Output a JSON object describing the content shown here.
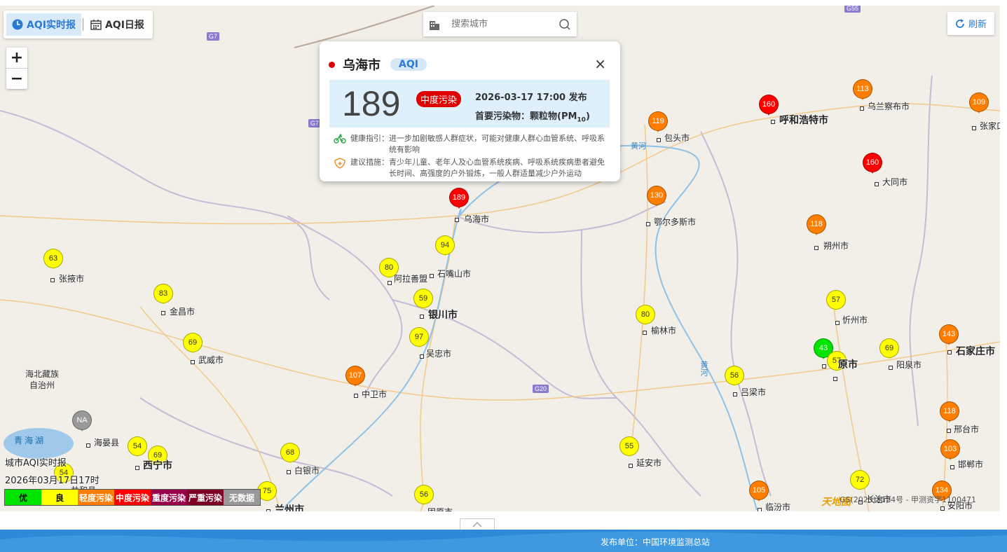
{
  "tabs": [
    {
      "label": "AQI实时报",
      "icon": "clock-icon",
      "active": true
    },
    {
      "label": "AQI日报",
      "icon": "calendar-icon",
      "active": false
    }
  ],
  "search": {
    "placeholder": "搜索城市"
  },
  "refresh": {
    "label": "刷新"
  },
  "zoom": {
    "in": "+",
    "out": "−"
  },
  "popup": {
    "city": "乌海市",
    "tag": "AQI",
    "aqi": "189",
    "level": "中度污染",
    "time": "2026-03-17 17:00 发布",
    "pollutant_label": "首要污染物：",
    "pollutant": "颗粒物(PM",
    "pollutant_sub": "10",
    "pollutant_end": ")",
    "health_label": "健康指引：",
    "health_text": "进一步加剧敏感人群症状，可能对健康人群心血管系统、呼吸系统有影响",
    "advice_label": "建议措施：",
    "advice_text": "青少年儿童、老年人及心血管系统疾病、呼吸系统疾病患者避免长时间、高强度的户外锻炼，一般人群适量减少户外运动",
    "close": "×"
  },
  "colors": {
    "good": "#ffff00",
    "excellent": "#00e400",
    "light": "#ff7e00",
    "moderate": "#ff0000",
    "heavy": "#99004c",
    "severe": "#7e0023",
    "nodata": "#999999"
  },
  "stations": [
    {
      "value": "189",
      "level": "moderate",
      "city": "乌海市"
    },
    {
      "value": "160",
      "level": "moderate",
      "city": "呼和浩特市"
    },
    {
      "value": "160",
      "level": "moderate",
      "city": "大同市"
    },
    {
      "value": "113",
      "level": "light",
      "city": "乌兰察布市"
    },
    {
      "value": "109",
      "level": "light",
      "city": "张家口"
    },
    {
      "value": "119",
      "level": "light",
      "city": "包头市"
    },
    {
      "value": "130",
      "level": "light",
      "city": "鄂尔多斯市"
    },
    {
      "value": "118",
      "level": "light",
      "city": "朔州市"
    },
    {
      "value": "94",
      "level": "good",
      "city": "石嘴山市"
    },
    {
      "value": "80",
      "level": "good",
      "city": "阿拉善盟"
    },
    {
      "value": "59",
      "level": "good",
      "city": "银川市"
    },
    {
      "value": "97",
      "level": "good",
      "city": "吴忠市"
    },
    {
      "value": "107",
      "level": "light",
      "city": "中卫市"
    },
    {
      "value": "63",
      "level": "good",
      "city": "张掖市"
    },
    {
      "value": "83",
      "level": "good",
      "city": "金昌市"
    },
    {
      "value": "69",
      "level": "good",
      "city": "武威市"
    },
    {
      "value": "80",
      "level": "good",
      "city": "榆林市"
    },
    {
      "value": "57",
      "level": "good",
      "city": "忻州市"
    },
    {
      "value": "43",
      "level": "excellent",
      "city": ""
    },
    {
      "value": "57",
      "level": "good",
      "city": ""
    },
    {
      "value": "69",
      "level": "good",
      "city": "阳泉市"
    },
    {
      "value": "143",
      "level": "light",
      "city": "石家庄市"
    },
    {
      "value": "56",
      "level": "good",
      "city": "吕梁市"
    },
    {
      "value": "118",
      "level": "light",
      "city": "邢台市"
    },
    {
      "value": "103",
      "level": "light",
      "city": "邯郸市"
    },
    {
      "value": "NA",
      "level": "nodata",
      "city": "海晏县"
    },
    {
      "value": "54",
      "level": "good",
      "city": ""
    },
    {
      "value": "69",
      "level": "good",
      "city": "西宁市"
    },
    {
      "value": "54",
      "level": "good",
      "city": "共和县"
    },
    {
      "value": "68",
      "level": "good",
      "city": "白银市"
    },
    {
      "value": "75",
      "level": "good",
      "city": "兰州市"
    },
    {
      "value": "55",
      "level": "good",
      "city": "延安市"
    },
    {
      "value": "56",
      "level": "good",
      "city": "固原市"
    },
    {
      "value": "105",
      "level": "light",
      "city": "临汾市"
    },
    {
      "value": "72",
      "level": "good",
      "city": "长治市"
    },
    {
      "value": "134",
      "level": "light",
      "city": "安阳市"
    }
  ],
  "labels": {
    "taiyuan_suffix": "原市",
    "region_haibei": "海北藏族\n自治州",
    "lake_qinghai": "青海湖",
    "river": "黄河",
    "roads": [
      "G7",
      "G55",
      "G20",
      "G7"
    ]
  },
  "legend": {
    "title": "城市AQI实时报",
    "time": "2026年03月17日17时",
    "items": [
      {
        "label": "优",
        "color": "#00e400",
        "text": "#000000"
      },
      {
        "label": "良",
        "color": "#ffff00",
        "text": "#000000"
      },
      {
        "label": "轻度污染",
        "color": "#ff7e00",
        "text": "#ffffff"
      },
      {
        "label": "中度污染",
        "color": "#ff0000",
        "text": "#ffffff"
      },
      {
        "label": "重度污染",
        "color": "#99004c",
        "text": "#ffffff"
      },
      {
        "label": "严重污染",
        "color": "#7e0023",
        "text": "#ffffff"
      },
      {
        "label": "无数据",
        "color": "#999999",
        "text": "#ffffff"
      }
    ]
  },
  "copyright": "GS(2023)3124号 - 甲测资字1100471",
  "logo": "天地图",
  "footer": {
    "publisher": "发布单位：中国环境监测总站"
  }
}
